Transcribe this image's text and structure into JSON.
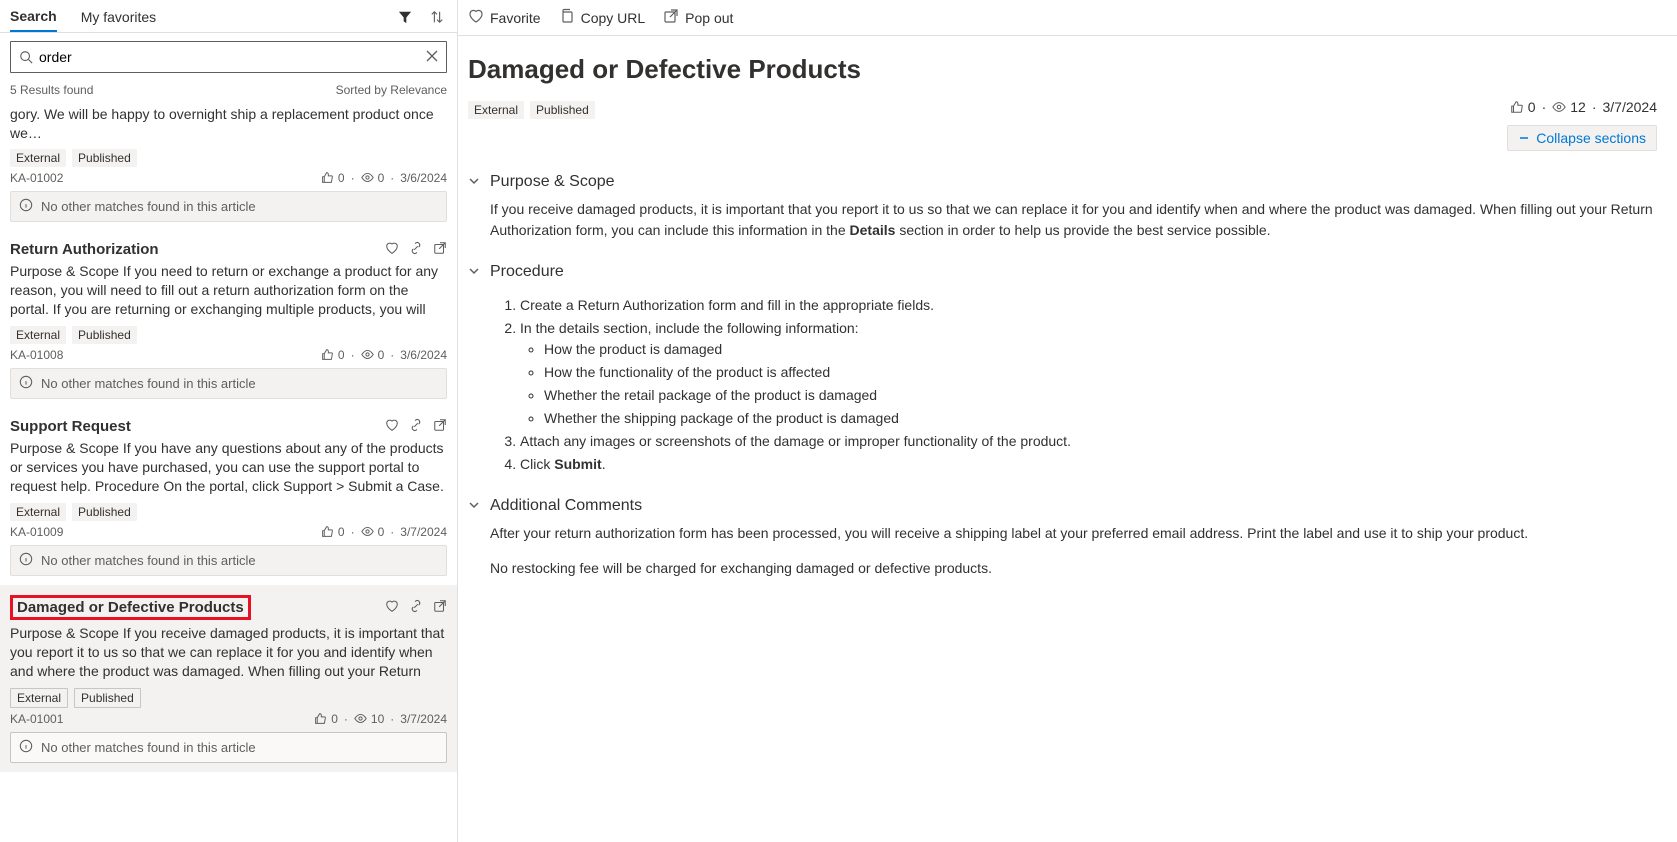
{
  "leftPane": {
    "tabs": {
      "search": "Search",
      "favorites": "My favorites"
    },
    "search": {
      "value": "order"
    },
    "resultsCount": "5 Results found",
    "sortLabel": "Sorted by Relevance",
    "results": [
      {
        "title": "",
        "snippet": "gory. We will be happy to overnight ship a replacement product once we…",
        "badges": [
          "External",
          "Published"
        ],
        "id": "KA-01002",
        "likes": "0",
        "views": "0",
        "date": "3/6/2024",
        "noMatch": "No other matches found in this article",
        "selected": false,
        "highlight": false,
        "showHead": false
      },
      {
        "title": "Return Authorization",
        "snippet": "Purpose & Scope If you need to return or exchange a product for any reason, you will need to fill out a return authorization form on the portal. If you are returning or exchanging multiple products, you will need to fill out…",
        "badges": [
          "External",
          "Published"
        ],
        "id": "KA-01008",
        "likes": "0",
        "views": "0",
        "date": "3/6/2024",
        "noMatch": "No other matches found in this article",
        "selected": false,
        "highlight": false,
        "showHead": true
      },
      {
        "title": "Support Request",
        "snippet": "Purpose & Scope If you have any questions about any of the products or services you have purchased, you can use the support portal to request help. Procedure On the portal, click Support > Submit a Case. Fill in your n…",
        "badges": [
          "External",
          "Published"
        ],
        "id": "KA-01009",
        "likes": "0",
        "views": "0",
        "date": "3/7/2024",
        "noMatch": "No other matches found in this article",
        "selected": false,
        "highlight": false,
        "showHead": true
      },
      {
        "title": "Damaged or Defective Products",
        "snippet": "  Purpose & Scope If you receive damaged products, it is important that you report it to us so that we can replace it for you and identify when and where the product was damaged. When filling out your Return Authorizat…",
        "badges": [
          "External",
          "Published"
        ],
        "id": "KA-01001",
        "likes": "0",
        "views": "10",
        "date": "3/7/2024",
        "noMatch": "No other matches found in this article",
        "selected": true,
        "highlight": true,
        "showHead": true
      }
    ]
  },
  "article": {
    "actions": {
      "favorite": "Favorite",
      "copyurl": "Copy URL",
      "popout": "Pop out"
    },
    "title": "Damaged or Defective Products",
    "badges": [
      "External",
      "Published"
    ],
    "likes": "0",
    "views": "12",
    "date": "3/7/2024",
    "collapseLabel": "Collapse sections",
    "sections": {
      "s1": {
        "title": "Purpose & Scope",
        "textPre": "If you receive damaged products, it is important that you report it to us so that we can replace it for you and identify when and where the product was damaged. When filling out your Return Authorization form, you can include this information in the ",
        "bold": "Details",
        "textPost": " section in order to help us provide the best service possible."
      },
      "s2": {
        "title": "Procedure",
        "step1": "Create a Return Authorization form and fill in the appropriate fields.",
        "step2": "In the details section, include the following information:",
        "sub1": "How the product is damaged",
        "sub2": "How the functionality of the product is affected",
        "sub3": "Whether the retail package of the product is damaged",
        "sub4": "Whether the shipping package of the product is damaged",
        "step3": "Attach any images or screenshots of the damage or improper functionality of the product.",
        "step4pre": "Click ",
        "step4bold": "Submit",
        "step4post": "."
      },
      "s3": {
        "title": "Additional Comments",
        "p1": "After your return authorization form has been processed, you will receive a shipping label at your preferred email address. Print the label and use it to ship your product.",
        "p2": "No restocking fee will be charged for exchanging damaged or defective products."
      }
    }
  }
}
